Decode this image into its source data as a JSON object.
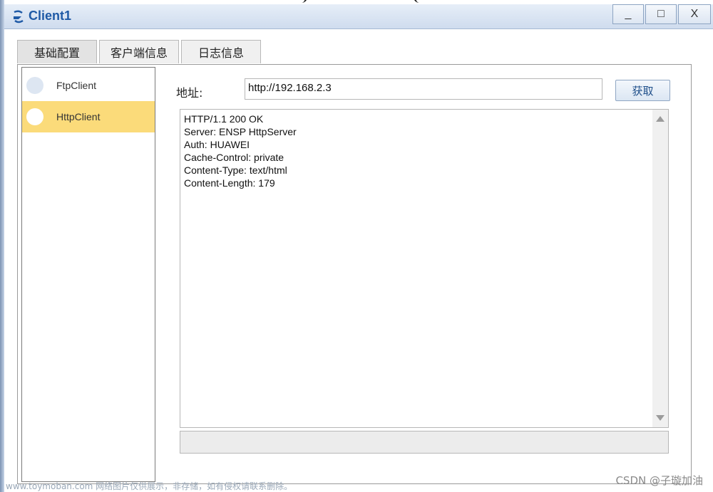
{
  "window": {
    "title": "Client1",
    "minimize_label": "_",
    "maximize_label": "□",
    "close_label": "X"
  },
  "tabs": [
    {
      "label": "基础配置",
      "active": true
    },
    {
      "label": "客户端信息",
      "active": false
    },
    {
      "label": "日志信息",
      "active": false
    }
  ],
  "clients": [
    {
      "label": "FtpClient",
      "selected": false
    },
    {
      "label": "HttpClient",
      "selected": true
    }
  ],
  "address": {
    "label": "地址:",
    "value": "http://192.168.2.3"
  },
  "fetch_button": {
    "label": "获取"
  },
  "response": {
    "lines": [
      "HTTP/1.1 200 OK",
      "Server: ENSP HttpServer",
      "Auth: HUAWEI",
      "Cache-Control: private",
      "Content-Type: text/html",
      "Content-Length: 179"
    ]
  },
  "watermarks": {
    "left": "www.toymoban.com 网络图片仅供展示，非存储，如有侵权请联系删除。",
    "right": "CSDN @子璇加油"
  },
  "colors": {
    "selected_item": "#fbdb7a",
    "title_text": "#1f5aa6",
    "titlebar": "#cfdcee"
  }
}
